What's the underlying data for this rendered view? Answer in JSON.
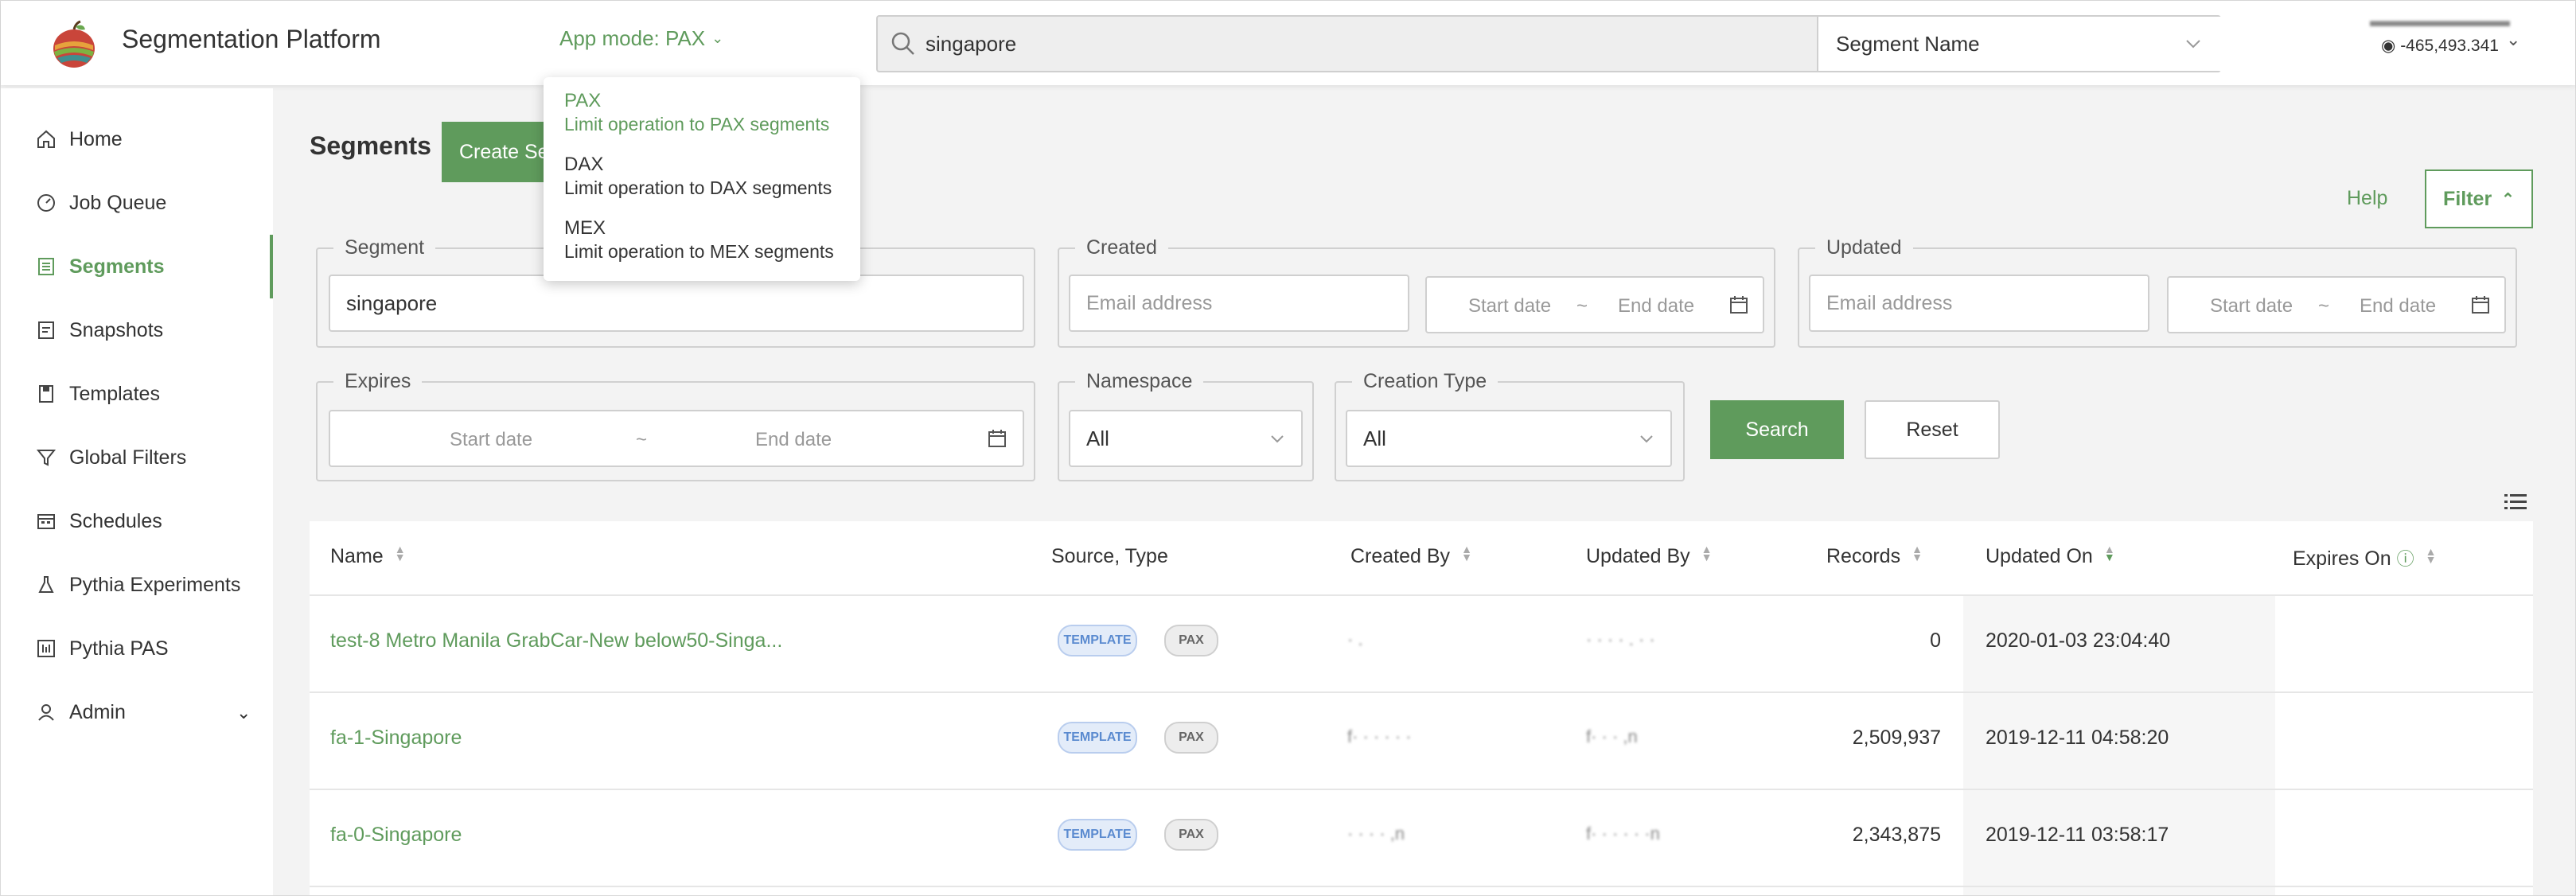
{
  "header": {
    "brand": "Segmentation Platform",
    "app_mode_label": "App mode: PAX",
    "search_value": "singapore",
    "search_field": "Segment Name",
    "user_balance": "-465,493.341"
  },
  "app_mode_menu": [
    {
      "title": "PAX",
      "desc": "Limit operation to PAX segments",
      "active": true
    },
    {
      "title": "DAX",
      "desc": "Limit operation to DAX segments",
      "active": false
    },
    {
      "title": "MEX",
      "desc": "Limit operation to MEX segments",
      "active": false
    }
  ],
  "sidebar": {
    "items": [
      {
        "label": "Home",
        "icon": "home-icon"
      },
      {
        "label": "Job Queue",
        "icon": "gauge-icon"
      },
      {
        "label": "Segments",
        "icon": "segments-icon",
        "active": true
      },
      {
        "label": "Snapshots",
        "icon": "snapshot-icon"
      },
      {
        "label": "Templates",
        "icon": "template-icon"
      },
      {
        "label": "Global Filters",
        "icon": "filter-icon"
      },
      {
        "label": "Schedules",
        "icon": "calendar-icon"
      },
      {
        "label": "Pythia Experiments",
        "icon": "flask-icon"
      },
      {
        "label": "Pythia PAS",
        "icon": "report-icon"
      },
      {
        "label": "Admin",
        "icon": "user-icon"
      }
    ]
  },
  "main": {
    "title": "Segments",
    "create_label": "Create Segment",
    "help_label": "Help",
    "filter_label": "Filter"
  },
  "filters": {
    "segment": {
      "legend": "Segment",
      "value": "singapore"
    },
    "created": {
      "legend": "Created",
      "email_placeholder": "Email address",
      "start": "Start date",
      "sep": "~",
      "end": "End date"
    },
    "updated": {
      "legend": "Updated",
      "email_placeholder": "Email address",
      "start": "Start date",
      "sep": "~",
      "end": "End date"
    },
    "expires": {
      "legend": "Expires",
      "start": "Start date",
      "sep": "~",
      "end": "End date"
    },
    "namespace": {
      "legend": "Namespace",
      "value": "All"
    },
    "creation_type": {
      "legend": "Creation Type",
      "value": "All"
    },
    "search_label": "Search",
    "reset_label": "Reset"
  },
  "table": {
    "columns": [
      "Name",
      "Source, Type",
      "Created By",
      "Updated By",
      "Records",
      "Updated On",
      "Expires On"
    ],
    "rows": [
      {
        "name": "test-8 Metro Manila GrabCar-New below50-Singa...",
        "source": "TEMPLATE",
        "type": "PAX",
        "created_by": "·  .",
        "updated_by": "· · · · . · ·",
        "records": "0",
        "updated_on": "2020-01-03 23:04:40",
        "expires_on": ""
      },
      {
        "name": "fa-1-Singapore",
        "source": "TEMPLATE",
        "type": "PAX",
        "created_by": "f· · · · · ·",
        "updated_by": "f· · · ,n",
        "records": "2,509,937",
        "updated_on": "2019-12-11 04:58:20",
        "expires_on": ""
      },
      {
        "name": "fa-0-Singapore",
        "source": "TEMPLATE",
        "type": "PAX",
        "created_by": "· · · · ,n",
        "updated_by": "f· · · · · ·n",
        "records": "2,343,875",
        "updated_on": "2019-12-11 03:58:17",
        "expires_on": ""
      }
    ]
  },
  "colors": {
    "accent": "#5f9b5c",
    "tag_blue": "#5b8bd0"
  }
}
